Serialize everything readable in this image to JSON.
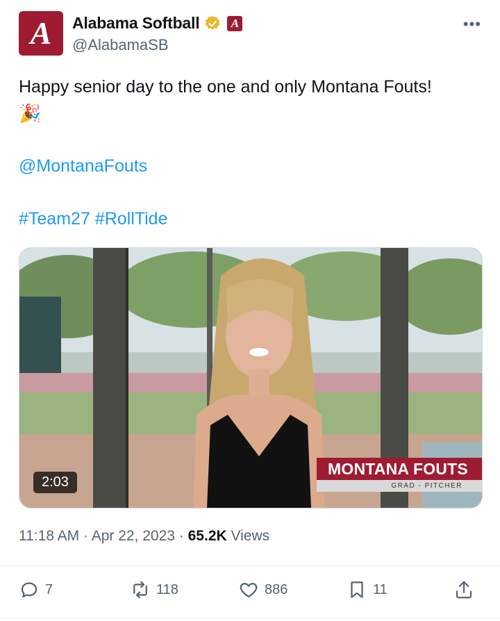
{
  "author": {
    "avatar_letter": "A",
    "display_name": "Alabama Softball",
    "handle": "@AlabamaSB",
    "verified_icon": "verified-badge-icon",
    "affiliation_letter": "A",
    "more_label": "•••"
  },
  "tweet": {
    "line1": "Happy senior day to the one and only Montana Fouts!",
    "emoji": "🎉",
    "mention": "@MontanaFouts",
    "hashtag1": "#Team27",
    "hashtag2": "#RollTide"
  },
  "media": {
    "duration": "2:03",
    "lower_third_name": "MONTANA FOUTS",
    "lower_third_subtitle": "GRAD - PITCHER"
  },
  "meta": {
    "time": "11:18 AM",
    "sep1": " · ",
    "date": "Apr 22, 2023",
    "sep2": " · ",
    "views_count": "65.2K",
    "views_label": " Views"
  },
  "actions": {
    "replies": "7",
    "reposts": "118",
    "likes": "886",
    "bookmarks": "11"
  },
  "colors": {
    "brand_crimson": "#9e1b32",
    "link_blue": "#1d9bf0",
    "secondary_text": "#536471",
    "verified_gold": "#e8b829"
  }
}
